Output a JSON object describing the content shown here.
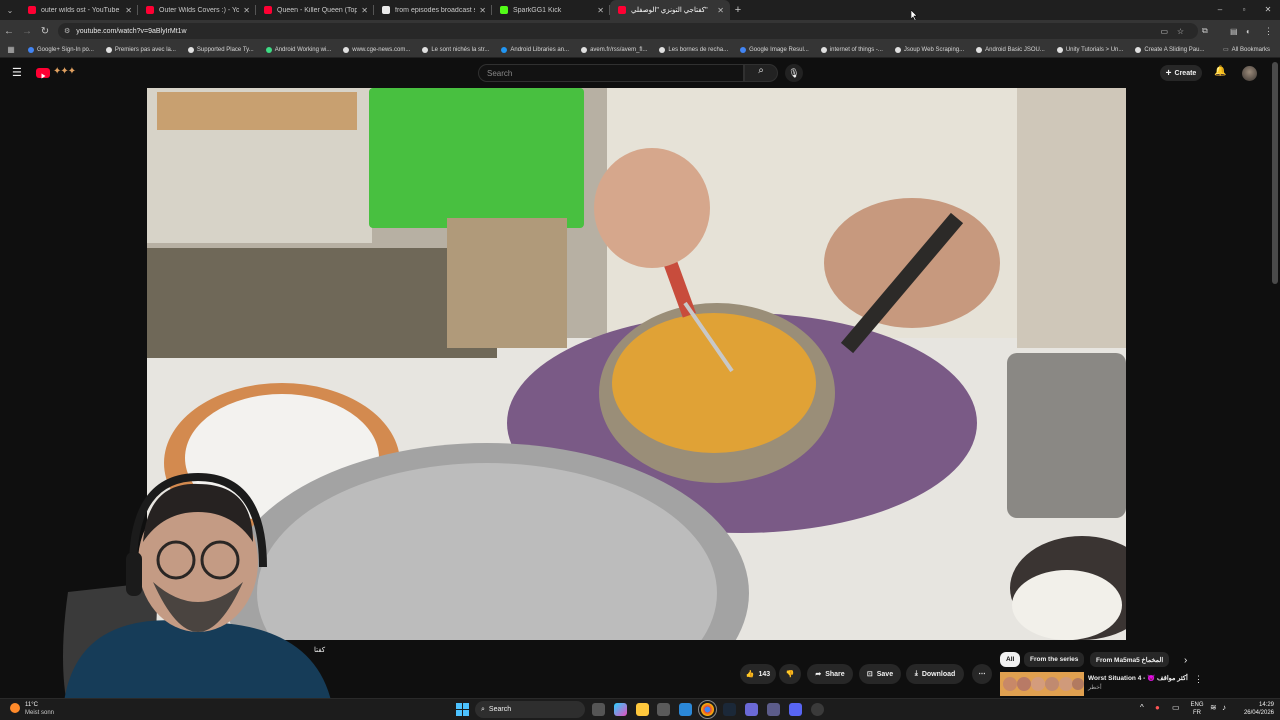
{
  "browser": {
    "tabs": [
      {
        "title": "outer wilds ost - YouTube",
        "favicon_color": "#ff0033",
        "active": false
      },
      {
        "title": "Outer Wilds Covers :) - YouTub",
        "favicon_color": "#ff0033",
        "active": false
      },
      {
        "title": "Queen - Killer Queen (Top Of T",
        "favicon_color": "#ff0033",
        "active": false
      },
      {
        "title": "from episodes broadcast sche",
        "favicon_color": "#e8e8e8",
        "active": false
      },
      {
        "title": "SparkGG1 Kick",
        "favicon_color": "#53fc18",
        "active": false
      },
      {
        "title": "كفتاجي التونزي \"الوصفلي\"",
        "favicon_color": "#ff0033",
        "active": true
      }
    ],
    "new_tab_label": "+",
    "url": "youtube.com/watch?v=9aBlyIrMt1w",
    "bookmarks": [
      {
        "label": "Google+ Sign-In po...",
        "color": "#4285f4"
      },
      {
        "label": "Premiers pas avec la...",
        "color": "#e0e0e0"
      },
      {
        "label": "Supported Place Ty...",
        "color": "#e0e0e0"
      },
      {
        "label": "Android Working wi...",
        "color": "#3ddc84"
      },
      {
        "label": "www.cge-news.com...",
        "color": "#e0e0e0"
      },
      {
        "label": "Le sont nichés la str...",
        "color": "#e0e0e0"
      },
      {
        "label": "Android Libraries an...",
        "color": "#2196f3"
      },
      {
        "label": "avem.fr/rss/avem_fl...",
        "color": "#e0e0e0"
      },
      {
        "label": "Les bornes de recha...",
        "color": "#e0e0e0"
      },
      {
        "label": "Google Image Resul...",
        "color": "#4285f4"
      },
      {
        "label": "internet of things -...",
        "color": "#e0e0e0"
      },
      {
        "label": "Jsoup Web Scraping...",
        "color": "#e0e0e0"
      },
      {
        "label": "Android Basic JSOU...",
        "color": "#e0e0e0"
      },
      {
        "label": "Unity Tutorials > Un...",
        "color": "#e0e0e0"
      },
      {
        "label": "Create A Sliding Pau...",
        "color": "#e0e0e0"
      }
    ],
    "all_bookmarks_label": "All Bookmarks"
  },
  "youtube": {
    "search_placeholder": "Search",
    "create_label": "Create",
    "caption_fragment": "كفتا",
    "likes": "143",
    "share_label": "Share",
    "save_label": "Save",
    "download_label": "Download",
    "chips": [
      "All",
      "From the series",
      "From Ma5ma5 المخماخ"
    ],
    "rec_title": "Worst Situation 4 - 😈 أكثر مواقف",
    "rec_sub": "أخطر"
  },
  "taskbar": {
    "weather_temp": "11°C",
    "weather_desc": "Meist sonn",
    "search_label": "Search",
    "lang_top": "ENG",
    "lang_bottom": "FR",
    "time": "14:29",
    "date": "26/04/2026"
  },
  "colors": {
    "yt_red": "#ff0033",
    "page_bg": "#0f0f0f",
    "chrome_bg": "#1f1f1f",
    "toolbar_bg": "#353535"
  }
}
